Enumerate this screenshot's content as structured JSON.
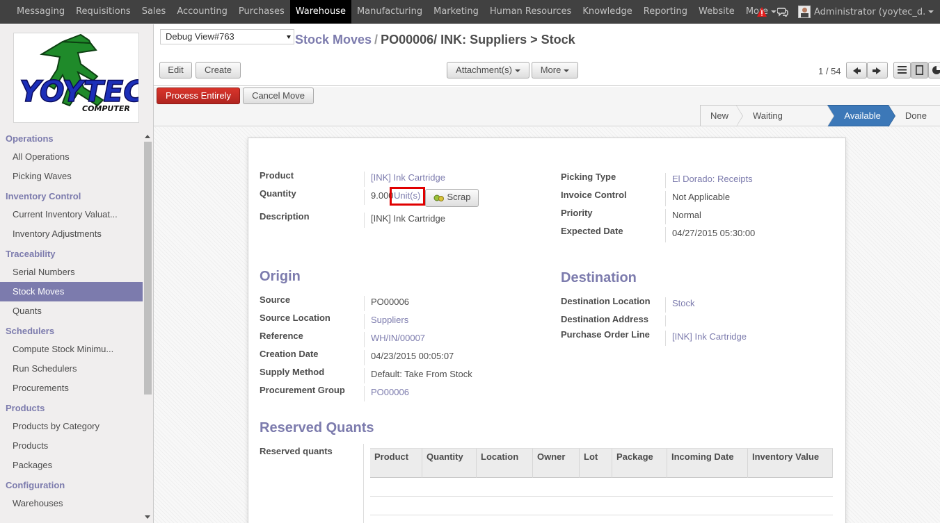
{
  "topbar": {
    "menu": [
      "Messaging",
      "Requisitions",
      "Sales",
      "Accounting",
      "Purchases",
      "Warehouse",
      "Manufacturing",
      "Marketing",
      "Human Resources",
      "Knowledge",
      "Reporting",
      "Website",
      "More"
    ],
    "active_index": 5,
    "user": "Administrator (yoytec_d..."
  },
  "sidebar": {
    "logo_text": "YOYTEC",
    "logo_subtext": "COMPUTER",
    "sections": [
      {
        "title": "Operations",
        "items": [
          "All Operations",
          "Picking Waves"
        ]
      },
      {
        "title": "Inventory Control",
        "items": [
          "Current Inventory Valuat...",
          "Inventory Adjustments"
        ]
      },
      {
        "title": "Traceability",
        "items": [
          "Serial Numbers",
          "Stock Moves",
          "Quants"
        ]
      },
      {
        "title": "Schedulers",
        "items": [
          "Compute Stock Minimu...",
          "Run Schedulers",
          "Procurements"
        ]
      },
      {
        "title": "Products",
        "items": [
          "Products by Category",
          "Products",
          "Packages"
        ]
      },
      {
        "title": "Configuration",
        "items": [
          "Warehouses"
        ]
      }
    ],
    "active_item": "Stock Moves"
  },
  "control_panel": {
    "debug_select": "Debug View#763",
    "breadcrumb_link": "Stock Moves",
    "breadcrumb_sep": "/",
    "breadcrumb_current": "PO00006/ INK: Suppliers > Stock",
    "edit": "Edit",
    "create": "Create",
    "attachments": "Attachment(s)",
    "more": "More",
    "pager": "1 / 54"
  },
  "header": {
    "process": "Process Entirely",
    "cancel": "Cancel Move",
    "statuses": [
      "New",
      "Waiting Availability",
      "Available",
      "Done"
    ],
    "current_status": "Available"
  },
  "form": {
    "product_label": "Product",
    "product": "[INK] Ink Cartridge",
    "quantity_label": "Quantity",
    "quantity": "9.000",
    "uom": "Unit(s)",
    "scrap": "Scrap",
    "description_label": "Description",
    "description": "[INK] Ink Cartridge",
    "picking_type_label": "Picking Type",
    "picking_type": "El Dorado: Receipts",
    "invoice_control_label": "Invoice Control",
    "invoice_control": "Not Applicable",
    "priority_label": "Priority",
    "priority": "Normal",
    "expected_date_label": "Expected Date",
    "expected_date": "04/27/2015 05:30:00",
    "origin_title": "Origin",
    "source_label": "Source",
    "source": "PO00006",
    "source_location_label": "Source Location",
    "source_location": "Suppliers",
    "reference_label": "Reference",
    "reference": "WH/IN/00007",
    "creation_date_label": "Creation Date",
    "creation_date": "04/23/2015 00:05:07",
    "supply_method_label": "Supply Method",
    "supply_method": "Default: Take From Stock",
    "procurement_group_label": "Procurement Group",
    "procurement_group": "PO00006",
    "destination_title": "Destination",
    "dest_location_label": "Destination Location",
    "dest_location": "Stock",
    "dest_address_label": "Destination Address",
    "po_line_label": "Purchase Order Line",
    "po_line": "[INK] Ink Cartridge",
    "reserved_title": "Reserved Quants",
    "reserved_label": "Reserved quants",
    "reserved_columns": [
      "Product",
      "Quantity",
      "Location",
      "Owner",
      "Lot",
      "Package",
      "Incoming Date",
      "Inventory Value"
    ]
  }
}
